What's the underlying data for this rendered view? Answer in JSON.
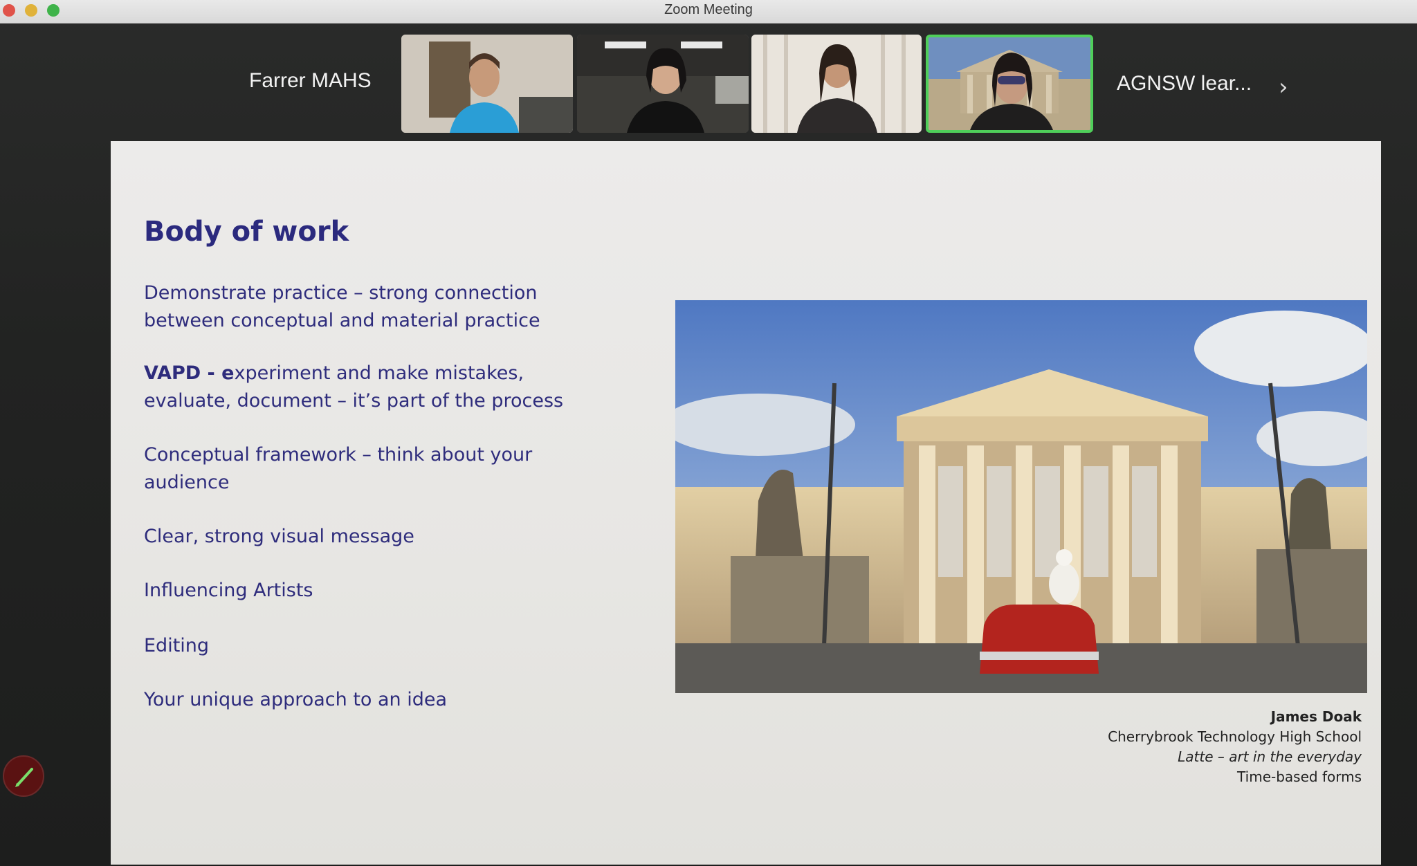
{
  "window": {
    "title": "Zoom Meeting"
  },
  "participants": {
    "left_name": "Farrer MAHS",
    "right_name": "AGNSW lear...",
    "more_icon": "chevron-right-icon"
  },
  "slide": {
    "title": "Body of work",
    "bullets": [
      {
        "text": "Demonstrate practice – strong connection\nbetween conceptual and material practice"
      },
      {
        "bold": "VAPD - e",
        "text": "xperiment and make mistakes,\nevaluate, document – it’s part of the process"
      },
      {
        "text": "Conceptual framework – think about your\naudience"
      },
      {
        "text": "Clear, strong visual message"
      },
      {
        "text": "Influencing Artists"
      },
      {
        "text": "Editing"
      },
      {
        "text": "Your unique approach to an idea"
      }
    ],
    "caption": {
      "name": "James Doak",
      "school": "Cherrybrook Technology High School",
      "work": "Latte – art in the everyday",
      "form": "Time-based forms"
    }
  },
  "colors": {
    "slide_text": "#2e2c7c",
    "active_speaker_border": "#4fcf5a",
    "titlebar": "#e0e0e0"
  }
}
